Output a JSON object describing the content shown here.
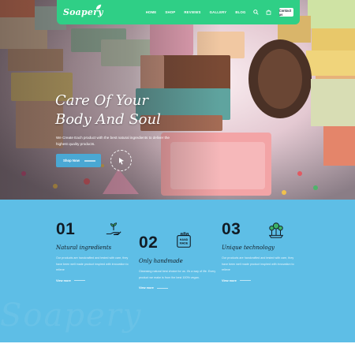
{
  "brand": {
    "name": "Soapery",
    "tagline": "",
    "color": "#2fcf86"
  },
  "nav": {
    "links": [
      "HOME",
      "SHOP",
      "REVIEWS",
      "GALLERY",
      "BLOG"
    ],
    "icons": [
      "search-icon",
      "cart-icon"
    ],
    "contact_label": "Contact us"
  },
  "hero": {
    "title_line1": "Care Of Your",
    "title_line2": "Body And Soul",
    "subtitle": "We Create Each product with the best natural ingredients to deliver the highest quality products.",
    "cta_label": "Shop Now",
    "circle_icon": "cursor-icon"
  },
  "features": {
    "background": "#5ebee6",
    "items": [
      {
        "number": "01",
        "title": "Natural ingredients",
        "icon": "hand-plant-icon",
        "text": "Our products are handcrafted and tested with care, they have been well made product inspired with innovation to relieve",
        "link": "View more"
      },
      {
        "number": "02",
        "title": "Only handmade",
        "icon": "hand-made-badge-icon",
        "text": "Cleansing natural best choice for us. It's a way of life. Every product we make is from the best 100% vegan.",
        "link": "View more"
      },
      {
        "number": "03",
        "title": "Unique technology",
        "icon": "plant-lab-icon",
        "text": "Our products are handcrafted and tested with care, they have been well made product inspired with innovation to relieve",
        "link": "View more"
      }
    ]
  }
}
